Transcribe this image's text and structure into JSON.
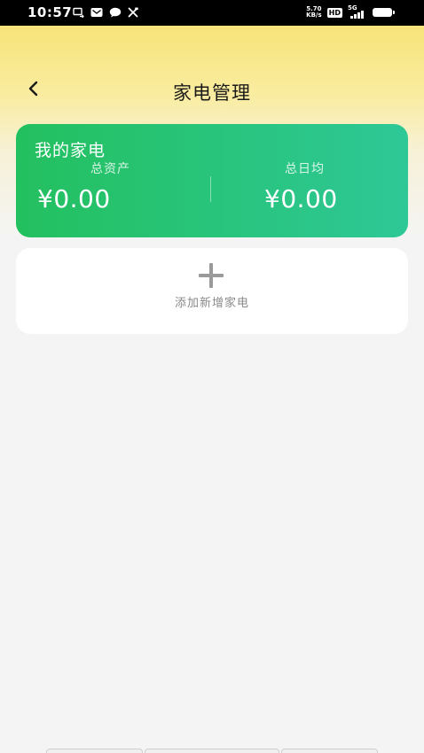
{
  "status_bar": {
    "time": "10:57",
    "net_speed_value": "5.70",
    "net_speed_unit": "KB/s",
    "hd_badge": "HD",
    "network_type": "5G",
    "left_icons": [
      "screen-mirror-icon",
      "mail-icon",
      "chat-icon",
      "tools-icon"
    ]
  },
  "header": {
    "title": "家电管理",
    "back_icon": "chevron-left-icon"
  },
  "summary_card": {
    "title": "我的家电",
    "total_assets_label": "总资产",
    "total_assets_value": "¥0.00",
    "daily_average_label": "总日均",
    "daily_average_value": "¥0.00",
    "gradient_start": "#23c05f",
    "gradient_end": "#2ec897"
  },
  "add_card": {
    "icon": "plus-icon",
    "label": "添加新增家电"
  },
  "colors": {
    "header_gradient_top": "#f8e47a",
    "page_background": "#f4f4f4"
  }
}
